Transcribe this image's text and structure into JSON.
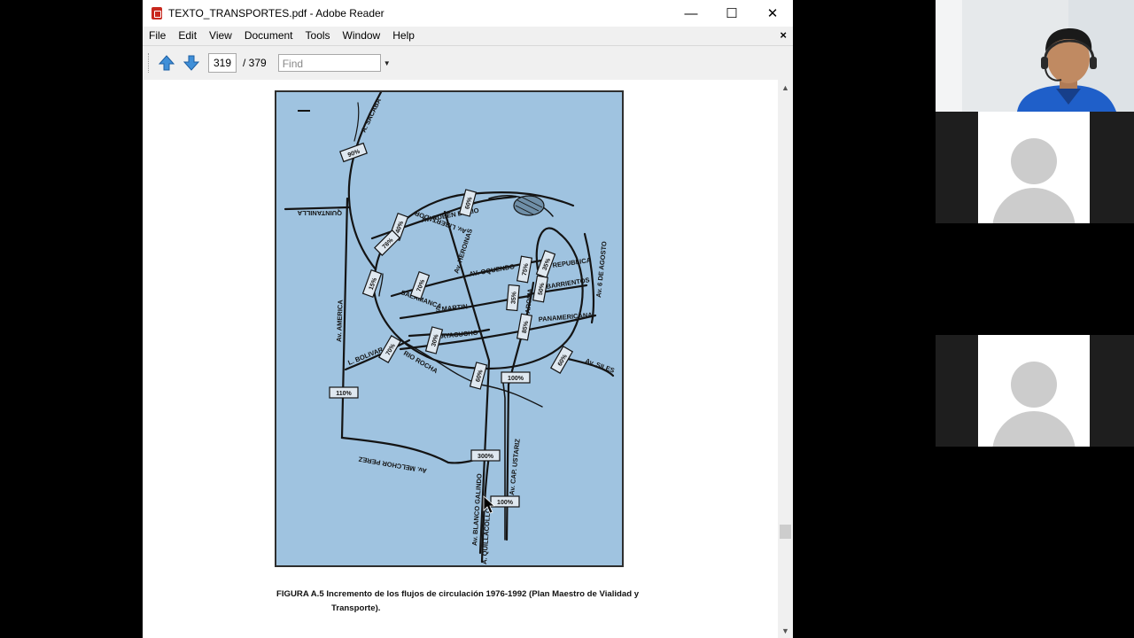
{
  "window": {
    "title": "TEXTO_TRANSPORTES.pdf - Adobe Reader",
    "minimize_glyph": "—",
    "maximize_glyph": "☐",
    "close_glyph": "✕"
  },
  "menu": {
    "items": [
      "File",
      "Edit",
      "View",
      "Document",
      "Tools",
      "Window",
      "Help"
    ],
    "close_glyph": "×"
  },
  "toolbar": {
    "current_page": "319",
    "page_total": "/ 379",
    "find_placeholder": "Find"
  },
  "map": {
    "labels": {
      "sacaba": "A. SACABA",
      "quintanilla": "QUINTANILLA",
      "rubendario": "Av. RUBEN DARIO",
      "libertador": "Av. LIBERTADOR",
      "heroinas": "Av. HEROINAS",
      "oquendo": "AV. OQUENDO",
      "republica": "REPUBLICA",
      "barrientos": "BARRIENTOS",
      "seisagosto": "Av. 6 DE AGOSTO",
      "america": "Av. AMERICA",
      "salamanca": "SALAMANCA",
      "smartin": "S.MARTIN",
      "panamericana": "PANAMERICANA",
      "aroma": "AROMA",
      "ayacucho": "AYACUCHO",
      "bolivar": "L. BOLIVAR",
      "riorocha": "RIO ROCHA",
      "siles": "Av. SILES",
      "melchor": "Av. MELCHOR PEREZ",
      "ustariz": "Av. CAP. USTARIZ",
      "blanco": "Av. BLANCO GALINDO",
      "quillacollo": "A. QUILLACOLLO"
    },
    "flows": [
      "90%",
      "40%",
      "60%",
      "76%",
      "15%",
      "70%",
      "35%",
      "75%",
      "35%",
      "50%",
      "85%",
      "30%",
      "70%",
      "60%",
      "60%",
      "110%",
      "100%",
      "300%",
      "100%"
    ]
  },
  "caption": {
    "line1": "FIGURA A.5  Incremento de los flujos de circulación 1976-1992 (Plan Maestro de Vialidad y",
    "line2": "Transporte)."
  }
}
